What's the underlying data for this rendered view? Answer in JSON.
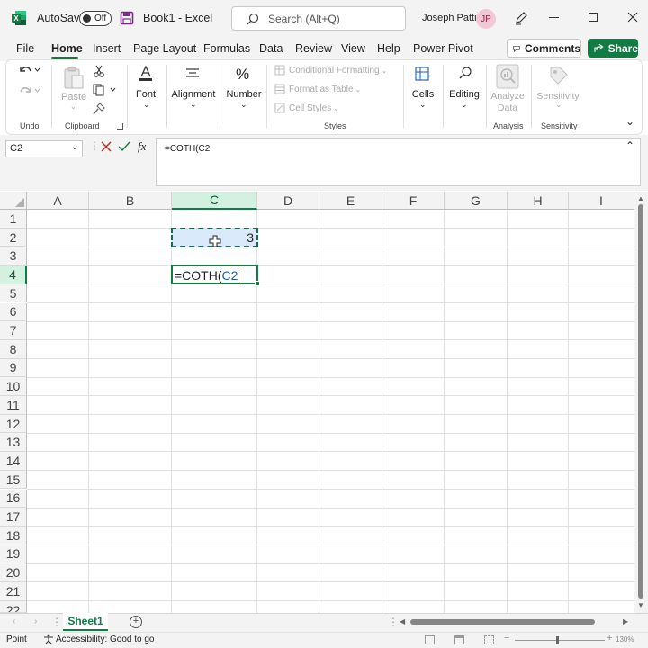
{
  "titlebar": {
    "autosave_label": "AutoSave",
    "autosave_state": "Off",
    "workbook": "Book1",
    "app": "Excel",
    "search_placeholder": "Search (Alt+Q)",
    "user_name": "Joseph Patti",
    "user_initials": "JP"
  },
  "menu": {
    "tabs": [
      "File",
      "Home",
      "Insert",
      "Page Layout",
      "Formulas",
      "Data",
      "Review",
      "View",
      "Help",
      "Power Pivot"
    ],
    "active_tab": "Home",
    "comments_label": "Comments",
    "share_label": "Share"
  },
  "ribbon": {
    "undo_group": "Undo",
    "paste_label": "Paste",
    "clipboard_group": "Clipboard",
    "font_label": "Font",
    "alignment_label": "Alignment",
    "number_label": "Number",
    "conditional_formatting": "Conditional Formatting",
    "format_as_table": "Format as Table",
    "cell_styles": "Cell Styles",
    "styles_group": "Styles",
    "cells_label": "Cells",
    "editing_label": "Editing",
    "analyze_data_label_1": "Analyze",
    "analyze_data_label_2": "Data",
    "analysis_group": "Analysis",
    "sensitivity_label": "Sensitivity",
    "sensitivity_group": "Sensitivity"
  },
  "formula_bar": {
    "name_box": "C2",
    "fx": "fx",
    "formula": "=COTH(C2"
  },
  "grid": {
    "columns": [
      "A",
      "B",
      "C",
      "D",
      "E",
      "F",
      "G",
      "H",
      "I"
    ],
    "rows": [
      "1",
      "2",
      "3",
      "4",
      "5",
      "6",
      "7",
      "8",
      "9",
      "10",
      "11",
      "12",
      "13",
      "14",
      "15",
      "16",
      "17",
      "18",
      "19",
      "20",
      "21",
      "22"
    ],
    "cell_c2_value": "3",
    "cell_c4_prefix": "=COTH(",
    "cell_c4_ref": "C2"
  },
  "sheet_tabs": {
    "active": "Sheet1"
  },
  "status_bar": {
    "mode": "Point",
    "accessibility": "Accessibility: Good to go",
    "zoom": "130%"
  },
  "colors": {
    "excel_green": "#107c41",
    "ref_blue": "#1e5aa8",
    "avatar_bg": "#f4c7d6",
    "avatar_fg": "#8b1e4a"
  }
}
